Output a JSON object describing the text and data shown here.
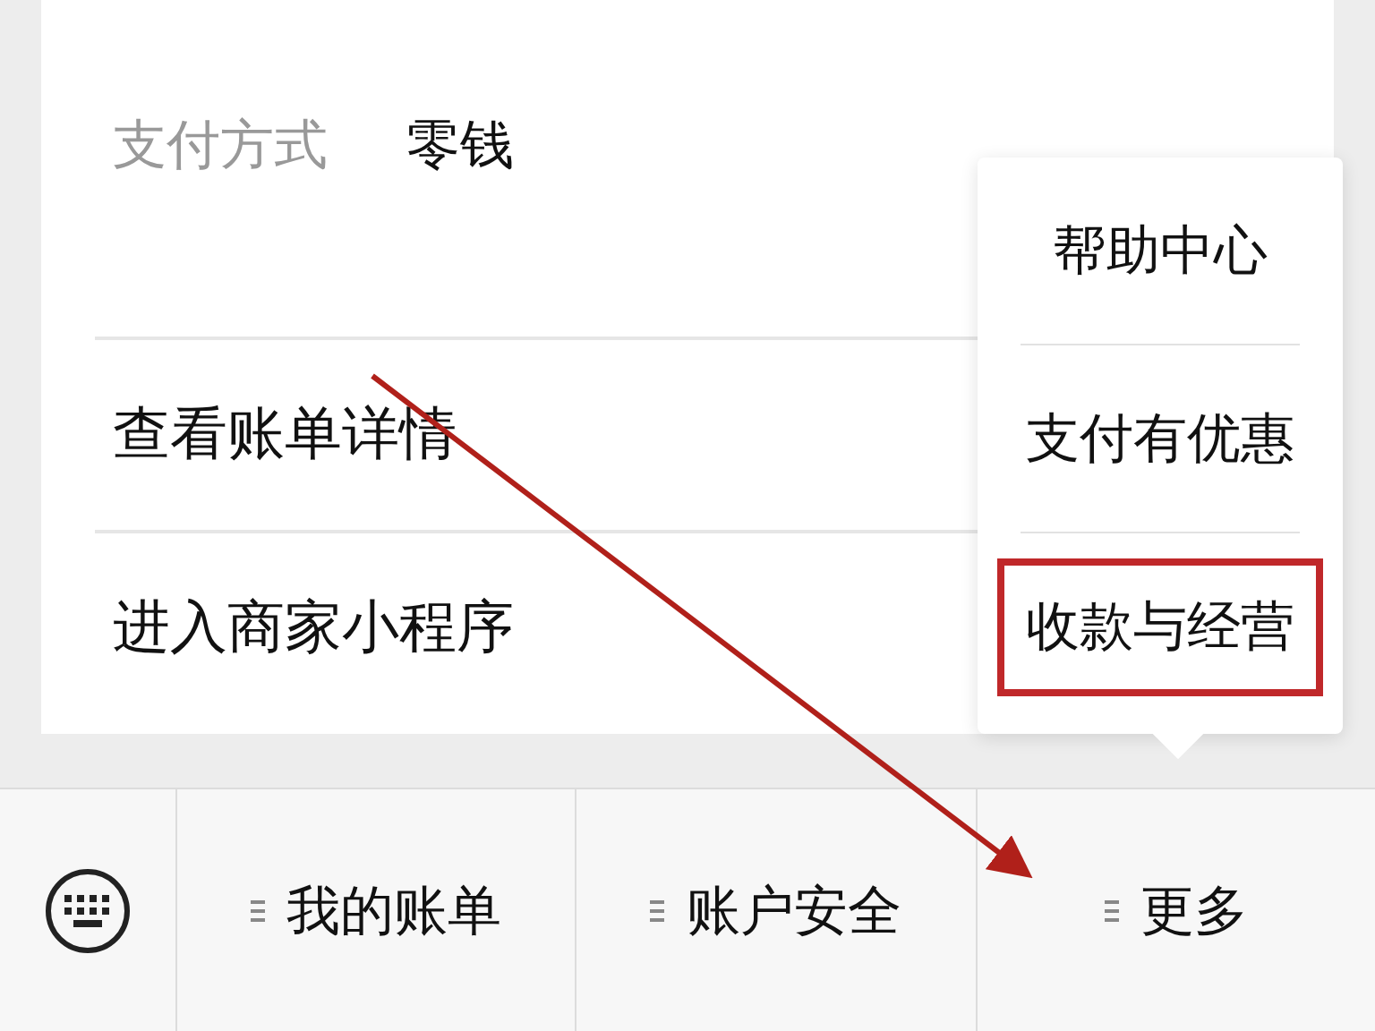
{
  "payment": {
    "label": "支付方式",
    "value": "零钱"
  },
  "links": [
    {
      "label": "查看账单详情"
    },
    {
      "label": "进入商家小程序"
    }
  ],
  "menu": [
    {
      "label": "帮助中心",
      "highlighted": false
    },
    {
      "label": "支付有优惠",
      "highlighted": false
    },
    {
      "label": "收款与经营",
      "highlighted": true
    }
  ],
  "bottom_bar": [
    {
      "label": "我的账单"
    },
    {
      "label": "账户安全"
    },
    {
      "label": "更多"
    }
  ]
}
